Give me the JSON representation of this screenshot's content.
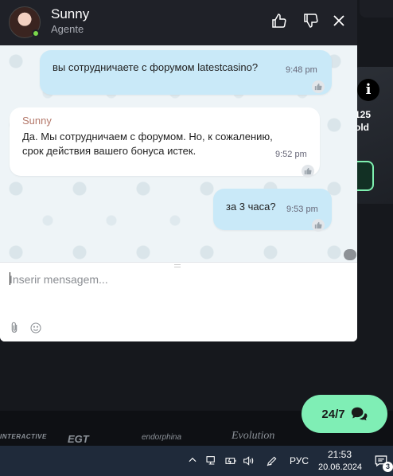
{
  "chat": {
    "agent_name": "Sunny",
    "agent_role": "Agente",
    "messages": [
      {
        "direction": "out",
        "text": "вы сотрудничаете с форумом  latestcasino?",
        "time": "9:48 pm"
      },
      {
        "direction": "in",
        "sender": "Sunny",
        "text_line1": "Да. Мы сотрудничаем с форумом. Но, к сожалению,",
        "text_line2": "срок действия вашего бонуса истек.",
        "time": "9:52 pm"
      },
      {
        "direction": "out",
        "text": "за 3 часа?",
        "time": "9:53 pm"
      }
    ],
    "composer": {
      "placeholder": "Inserir mensagem..."
    }
  },
  "background": {
    "promo_line1": "125",
    "promo_line2": "old",
    "providers": [
      "INTERACTIVE",
      "EGT",
      "endorphina",
      "Evolution"
    ]
  },
  "support_button": {
    "label": "24/7"
  },
  "taskbar": {
    "language": "РУС",
    "time": "21:53",
    "date": "20.06.2024",
    "notification_count": "3"
  },
  "colors": {
    "header_bg": "#1f2128",
    "outgoing_bubble": "#c9e9f8",
    "incoming_bubble": "#ffffff",
    "sender_name": "#b4786a",
    "support_button": "#7feeb5",
    "online_status": "#7bd84b"
  },
  "icons": {
    "thumbs_up": "thumbs-up-icon",
    "thumbs_down": "thumbs-down-icon",
    "close": "close-icon",
    "attach": "paperclip-icon",
    "emoji": "emoji-icon",
    "chat": "chat-bubbles-icon"
  }
}
